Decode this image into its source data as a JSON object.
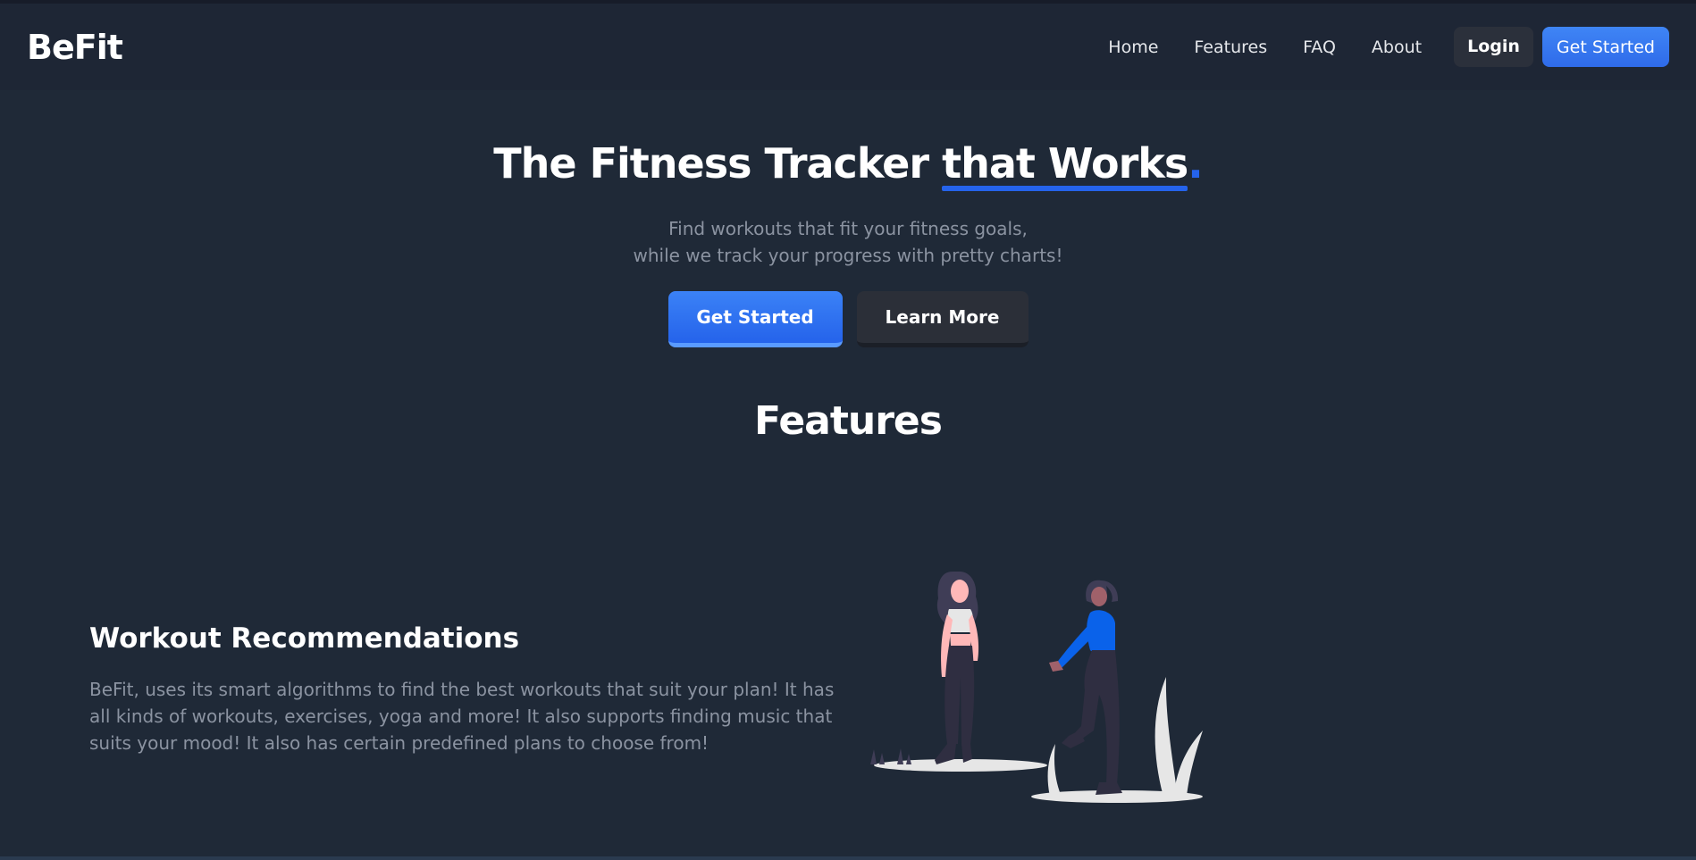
{
  "app": {
    "logo": "BeFit"
  },
  "nav": {
    "links": [
      "Home",
      "Features",
      "FAQ",
      "About"
    ],
    "login": "Login",
    "get_started": "Get Started"
  },
  "hero": {
    "title_part1": "The Fitness Tracker ",
    "title_highlight": "that Works",
    "title_dot": ".",
    "subtitle_line1": "Find workouts that fit your fitness goals,",
    "subtitle_line2": "while we track your progress with pretty charts!",
    "primary_button": "Get Started",
    "secondary_button": "Learn More"
  },
  "features": {
    "heading": "Features",
    "item": {
      "title": "Workout Recommendations",
      "description": "BeFit, uses its smart algorithms to find the best workouts that suit your plan! It has all kinds of workouts, exercises, yoga and more! It also supports finding music that suits your mood! It also has certain predefined plans to choose from!"
    }
  },
  "colors": {
    "background": "#1f2937",
    "navbar": "#1e2635",
    "accent": "#2563eb",
    "muted_text": "#8b93a1"
  }
}
